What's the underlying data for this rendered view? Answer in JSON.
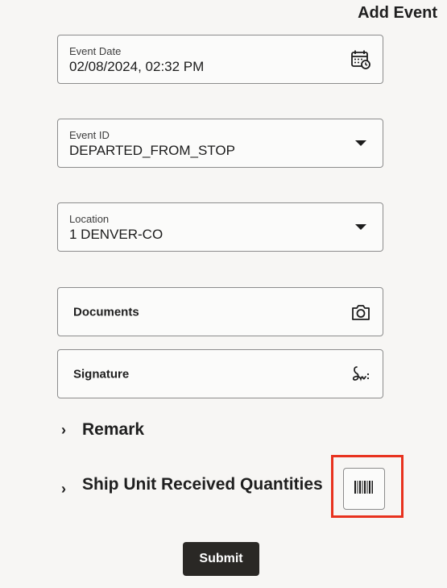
{
  "header": {
    "title": "Add Event"
  },
  "fields": {
    "event_date": {
      "label": "Event Date",
      "value": "02/08/2024, 02:32 PM",
      "icon": "calendar-clock-icon"
    },
    "event_id": {
      "label": "Event ID",
      "value": "DEPARTED_FROM_STOP",
      "icon": "dropdown-caret-icon"
    },
    "location": {
      "label": "Location",
      "value": "1 DENVER-CO",
      "icon": "dropdown-caret-icon"
    },
    "documents": {
      "label": "Documents",
      "icon": "camera-icon"
    },
    "signature": {
      "label": "Signature",
      "icon": "signature-icon"
    }
  },
  "sections": {
    "remark": {
      "label": "Remark",
      "chevron": "›"
    },
    "ship_unit": {
      "label": "Ship Unit Received Quantities",
      "chevron": "›"
    }
  },
  "barcode": {
    "icon": "barcode-icon",
    "highlight_color": "#e8321e"
  },
  "actions": {
    "submit_label": "Submit"
  }
}
